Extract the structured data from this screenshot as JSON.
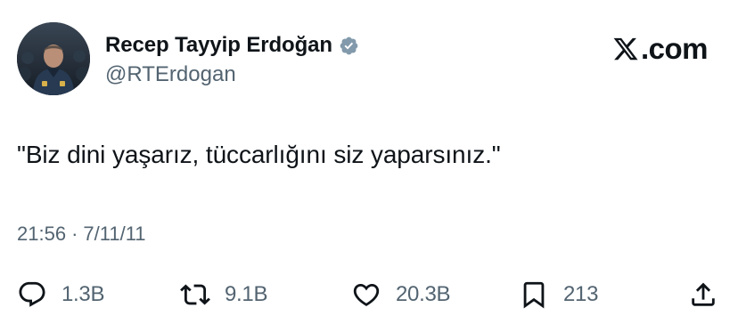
{
  "author": {
    "display_name": "Recep Tayyip Erdoğan",
    "handle": "@RTErdogan",
    "verified": true,
    "verified_color": "#829aab"
  },
  "brand": {
    "text": ".com",
    "icon": "x-logo-icon"
  },
  "tweet": {
    "text": "\"Biz dini yaşarız, tüccarlığını siz yaparsınız.\""
  },
  "meta": {
    "time": "21:56",
    "separator": "·",
    "date": "7/11/11"
  },
  "actions": {
    "reply": {
      "icon": "reply-icon",
      "count": "1.3B"
    },
    "retweet": {
      "icon": "retweet-icon",
      "count": "9.1B"
    },
    "like": {
      "icon": "heart-icon",
      "count": "20.3B"
    },
    "bookmark": {
      "icon": "bookmark-icon",
      "count": "213"
    },
    "share": {
      "icon": "share-icon"
    }
  },
  "colors": {
    "text": "#0f1419",
    "secondary": "#536471",
    "background": "#ffffff"
  }
}
